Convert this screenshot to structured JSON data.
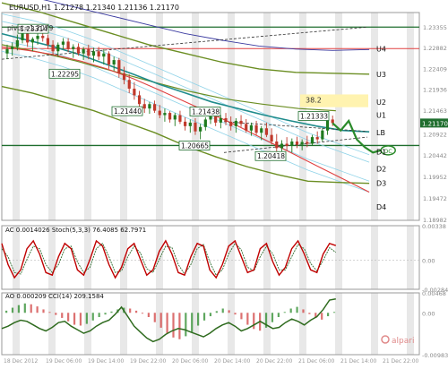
{
  "header": {
    "symbol_tf": "EURUSD,H1",
    "ohlc": "1.21278 1.21340 1.21136 1.21170",
    "pivot": "pivot=1.2079"
  },
  "colors": {
    "bull_candle": "#1e7a1e",
    "bear_candle": "#c0392b",
    "teal_ma": "#1f8c8c",
    "olive_bands": "#6b8e23",
    "red_ma": "#e04040",
    "navy_ma": "#3a3aa0",
    "light_blue": "#8fd3e8",
    "gray_bar": "#d9d9d9",
    "yellow_zone": "#fff3b0",
    "price_tag": "#1f6e2e",
    "stoch_main": "#c00000",
    "stoch_signal": "#2d6a2d",
    "ao_up": "#2a8a2a",
    "ao_down": "#d04040",
    "cci_line": "#2f6b1f"
  },
  "chart_data": [
    {
      "type": "line",
      "name": "main-price",
      "ylim": [
        1.1896,
        1.2368
      ],
      "yticks": [
        1.23355,
        1.22882,
        1.22409,
        1.21936,
        1.21463,
        1.20922,
        1.20442,
        1.19952,
        1.19472,
        1.18982
      ],
      "ytick_labels": [
        "1.23355",
        "1.22882",
        "1.22409",
        "1.21936",
        "1.21463",
        "1.20922",
        "1.20442",
        "1.19952",
        "1.19472",
        "1.18982"
      ],
      "current_price": 1.2117,
      "current_price_label": "1.21170",
      "level_labels": [
        {
          "text": "U4",
          "y": 1.2286
        },
        {
          "text": "U3",
          "y": 1.2228
        },
        {
          "text": "U2",
          "y": 1.2165
        },
        {
          "text": "U1",
          "y": 1.2135
        },
        {
          "text": "LB",
          "y": 1.2095
        },
        {
          "text": "D1",
          "y": 1.2052
        },
        {
          "text": "D2",
          "y": 1.2013
        },
        {
          "text": "D3",
          "y": 1.198
        },
        {
          "text": "D4",
          "y": 1.1927
        }
      ],
      "price_callouts": [
        {
          "text": "1.23314",
          "y": 1.2331
        },
        {
          "text": "1.22295",
          "y": 1.2229
        },
        {
          "text": "1.21440",
          "y": 1.2144
        },
        {
          "text": "1.21438",
          "y": 1.2143
        },
        {
          "text": "1.21333",
          "y": 1.2133
        },
        {
          "text": "1.20665",
          "y": 1.2066
        },
        {
          "text": "1.20418",
          "y": 1.2042
        }
      ],
      "fib_label": "38.2",
      "forecast_label": "OC",
      "candles": [
        [
          1.2275,
          1.2295,
          1.2262,
          1.2285
        ],
        [
          1.2285,
          1.23,
          1.227,
          1.229
        ],
        [
          1.229,
          1.2318,
          1.2282,
          1.2305
        ],
        [
          1.2305,
          1.2331,
          1.2298,
          1.232
        ],
        [
          1.232,
          1.2325,
          1.229,
          1.23
        ],
        [
          1.23,
          1.2312,
          1.228,
          1.2308
        ],
        [
          1.2308,
          1.232,
          1.2295,
          1.2315
        ],
        [
          1.2315,
          1.2326,
          1.2302,
          1.231
        ],
        [
          1.231,
          1.2318,
          1.2285,
          1.2295
        ],
        [
          1.2295,
          1.2305,
          1.227,
          1.228
        ],
        [
          1.228,
          1.23,
          1.2268,
          1.2295
        ],
        [
          1.2295,
          1.231,
          1.2285,
          1.2302
        ],
        [
          1.2302,
          1.231,
          1.2278,
          1.2285
        ],
        [
          1.2285,
          1.2296,
          1.2265,
          1.229
        ],
        [
          1.229,
          1.2298,
          1.227,
          1.2275
        ],
        [
          1.2275,
          1.229,
          1.226,
          1.2285
        ],
        [
          1.2285,
          1.2295,
          1.2262,
          1.227
        ],
        [
          1.227,
          1.2288,
          1.2255,
          1.228
        ],
        [
          1.228,
          1.229,
          1.226,
          1.2268
        ],
        [
          1.2268,
          1.2285,
          1.225,
          1.2275
        ],
        [
          1.2275,
          1.228,
          1.224,
          1.225
        ],
        [
          1.225,
          1.2268,
          1.2235,
          1.226
        ],
        [
          1.226,
          1.2265,
          1.222,
          1.223
        ],
        [
          1.223,
          1.2245,
          1.2205,
          1.2215
        ],
        [
          1.2215,
          1.2228,
          1.2185,
          1.2195
        ],
        [
          1.2195,
          1.221,
          1.217,
          1.218
        ],
        [
          1.218,
          1.219,
          1.215,
          1.216
        ],
        [
          1.216,
          1.2172,
          1.214,
          1.215
        ],
        [
          1.215,
          1.2165,
          1.2138,
          1.216
        ],
        [
          1.216,
          1.2168,
          1.214,
          1.2145
        ],
        [
          1.2145,
          1.2158,
          1.2128,
          1.2135
        ],
        [
          1.2135,
          1.215,
          1.212,
          1.214
        ],
        [
          1.214,
          1.2144,
          1.2118,
          1.2125
        ],
        [
          1.2125,
          1.214,
          1.211,
          1.2135
        ],
        [
          1.2135,
          1.2145,
          1.2115,
          1.212
        ],
        [
          1.212,
          1.213,
          1.21,
          1.211
        ],
        [
          1.211,
          1.2125,
          1.2095,
          1.2118
        ],
        [
          1.2118,
          1.2128,
          1.209,
          1.2098
        ],
        [
          1.2098,
          1.2115,
          1.208,
          1.2108
        ],
        [
          1.2108,
          1.213,
          1.21,
          1.2125
        ],
        [
          1.2125,
          1.2144,
          1.2115,
          1.2138
        ],
        [
          1.2138,
          1.2143,
          1.211,
          1.2118
        ],
        [
          1.2118,
          1.2135,
          1.2105,
          1.2128
        ],
        [
          1.2128,
          1.214,
          1.2112,
          1.212
        ],
        [
          1.212,
          1.2132,
          1.21,
          1.211
        ],
        [
          1.211,
          1.2128,
          1.2095,
          1.2122
        ],
        [
          1.2122,
          1.2135,
          1.2108,
          1.2115
        ],
        [
          1.2115,
          1.2126,
          1.2095,
          1.21
        ],
        [
          1.21,
          1.2118,
          1.2088,
          1.2112
        ],
        [
          1.2112,
          1.2122,
          1.209,
          1.2095
        ],
        [
          1.2095,
          1.211,
          1.2078,
          1.2105
        ],
        [
          1.2105,
          1.2118,
          1.2085,
          1.209
        ],
        [
          1.209,
          1.2105,
          1.2068,
          1.2075
        ],
        [
          1.2075,
          1.2092,
          1.205,
          1.206
        ],
        [
          1.206,
          1.2078,
          1.2042,
          1.207
        ],
        [
          1.207,
          1.2085,
          1.2055,
          1.2065
        ],
        [
          1.2065,
          1.2082,
          1.205,
          1.2075
        ],
        [
          1.2075,
          1.2086,
          1.206,
          1.2068
        ],
        [
          1.2068,
          1.208,
          1.2055,
          1.2074
        ],
        [
          1.2074,
          1.2088,
          1.2062,
          1.207
        ],
        [
          1.207,
          1.209,
          1.2065,
          1.2085
        ],
        [
          1.2085,
          1.2098,
          1.207,
          1.208
        ],
        [
          1.208,
          1.2105,
          1.2075,
          1.21
        ],
        [
          1.21,
          1.2133,
          1.209,
          1.2125
        ],
        [
          1.2125,
          1.2134,
          1.211,
          1.2117
        ]
      ],
      "teal_ma": [
        1.232,
        1.2305,
        1.229,
        1.2272,
        1.225,
        1.2228,
        1.2205,
        1.2185,
        1.2165,
        1.215,
        1.2135,
        1.2122,
        1.211,
        1.21,
        1.2097
      ],
      "red_ma": [
        1.229,
        1.2282,
        1.2272,
        1.2258,
        1.224,
        1.2218,
        1.2192,
        1.2165,
        1.2138,
        1.211,
        1.208,
        1.205,
        1.202,
        1.199,
        1.196
      ],
      "navy_ma": [
        1.242,
        1.24,
        1.238,
        1.236,
        1.234,
        1.232,
        1.2305,
        1.2292,
        1.2285,
        1.2282,
        1.2284
      ],
      "olive_upper": [
        1.239,
        1.237,
        1.2345,
        1.232,
        1.2295,
        1.2275,
        1.2255,
        1.224,
        1.2232,
        1.223,
        1.2228
      ],
      "olive_mid": [
        1.2295,
        1.2278,
        1.2258,
        1.2235,
        1.2212,
        1.219,
        1.2172,
        1.216,
        1.215,
        1.2145
      ],
      "olive_lower": [
        1.22,
        1.2185,
        1.2165,
        1.2145,
        1.212,
        1.2095,
        1.2065,
        1.204,
        1.2018,
        1.2,
        1.1985,
        1.1982,
        1.198
      ],
      "trend_upper": [
        [
          0,
          1.2262
        ],
        [
          1,
          1.2335
        ]
      ],
      "trend_lower": [
        [
          0,
          1.205
        ],
        [
          1,
          1.2085
        ]
      ],
      "forecast_path": [
        1.2117,
        1.21,
        1.2122,
        1.208,
        1.2062,
        1.205,
        1.2055
      ]
    },
    {
      "type": "line",
      "name": "AC-Stochastic",
      "label": "AC 0.0014026  Stoch(5,3,3) 76.4085 62.7971",
      "ylim": [
        -0.00284,
        0.00338
      ],
      "yticks": [
        0.00338,
        0.0,
        -0.00284
      ],
      "ytick_labels": [
        "0.00338",
        "0.00",
        "-0.00284"
      ],
      "stoch_main": [
        80,
        40,
        15,
        30,
        70,
        85,
        60,
        25,
        20,
        55,
        80,
        70,
        30,
        20,
        50,
        85,
        75,
        40,
        15,
        35,
        70,
        80,
        50,
        20,
        30,
        65,
        85,
        60,
        25,
        20,
        55,
        80,
        75,
        30,
        15,
        40,
        75,
        85,
        55,
        25,
        30,
        70,
        80,
        45,
        20,
        35,
        70,
        85,
        60,
        30,
        25,
        60,
        80,
        76
      ],
      "stoch_signal": [
        70,
        55,
        25,
        22,
        50,
        75,
        70,
        40,
        25,
        40,
        70,
        75,
        45,
        25,
        35,
        70,
        80,
        55,
        25,
        28,
        55,
        75,
        62,
        32,
        25,
        50,
        75,
        72,
        40,
        22,
        40,
        70,
        78,
        45,
        20,
        30,
        60,
        80,
        68,
        35,
        28,
        55,
        75,
        60,
        30,
        30,
        55,
        78,
        70,
        42,
        28,
        48,
        72,
        63
      ]
    },
    {
      "type": "bar",
      "name": "AO-CCI",
      "label": "AO 0.000209  CCI(14) 209.1584",
      "ylim": [
        -0.00983,
        0.00468
      ],
      "yticks": [
        0.00468,
        0.0,
        -0.00983
      ],
      "ytick_labels": [
        "0.00468",
        "0.00",
        "-0.00983"
      ],
      "ao_values": [
        0.0005,
        0.0012,
        0.0018,
        0.0022,
        0.002,
        0.0015,
        0.0008,
        0.0002,
        -0.0005,
        -0.0012,
        -0.002,
        -0.0028,
        -0.003,
        -0.0026,
        -0.0018,
        -0.001,
        -0.0004,
        0.0003,
        0.0008,
        0.0012,
        0.001,
        0.0005,
        -0.0002,
        -0.001,
        -0.0022,
        -0.0035,
        -0.0048,
        -0.0058,
        -0.0062,
        -0.0055,
        -0.0045,
        -0.003,
        -0.0018,
        -0.0008,
        0.0004,
        0.001,
        0.0006,
        -0.0004,
        -0.0015,
        -0.0028,
        -0.0038,
        -0.0042,
        -0.0035,
        -0.0022,
        -0.001,
        0.0002,
        0.001,
        0.0014,
        0.0008,
        -0.0003,
        -0.0012,
        -0.0016,
        -0.0008,
        0.0002
      ],
      "cci": [
        -40,
        -20,
        10,
        30,
        20,
        -10,
        -40,
        -60,
        -30,
        10,
        20,
        -20,
        -50,
        -80,
        -60,
        -20,
        10,
        30,
        80,
        140,
        60,
        -20,
        -70,
        -120,
        -150,
        -130,
        -90,
        -60,
        -40,
        -50,
        -70,
        -90,
        -110,
        -80,
        -40,
        -10,
        10,
        -20,
        -60,
        -40,
        -10,
        20,
        -10,
        -40,
        -30,
        10,
        40,
        20,
        -10,
        30,
        60,
        120,
        200,
        209
      ]
    }
  ],
  "time_axis": {
    "labels": [
      "18 Dec 2012",
      "19 Dec 06:00",
      "19 Dec 14:00",
      "19 Dec 22:00",
      "20 Dec 06:00",
      "20 Dec 14:00",
      "20 Dec 22:00",
      "21 Dec 06:00",
      "21 Dec 14:00",
      "21 Dec 22:00"
    ]
  },
  "watermark": "alpari"
}
